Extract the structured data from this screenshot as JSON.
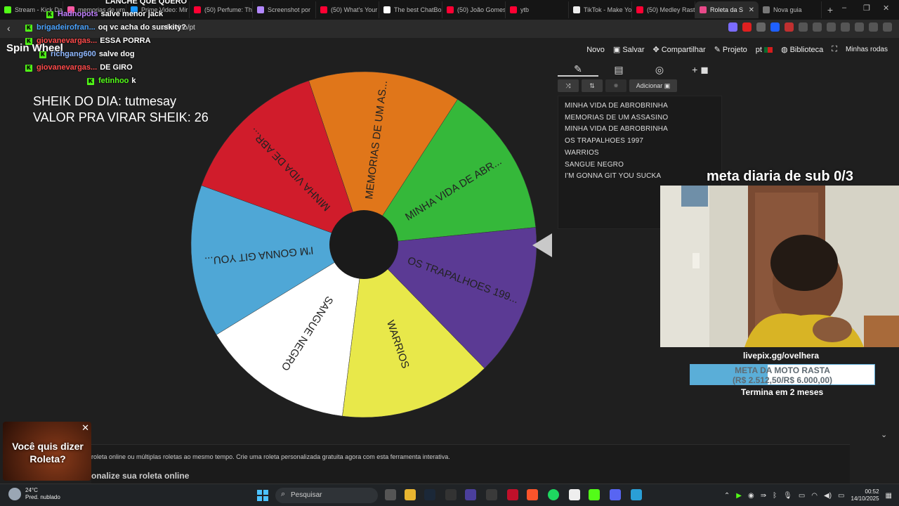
{
  "browser": {
    "tabs": [
      {
        "label": "Stream - Kick Da",
        "color": "#53fc18"
      },
      {
        "label": "memorias de um",
        "color": "#ff5aa5"
      },
      {
        "label": "Prime Video: Mir",
        "color": "#1a98ff"
      },
      {
        "label": "(50) Perfume: Th",
        "color": "#ff0033"
      },
      {
        "label": "Screenshot por",
        "color": "#b388ff"
      },
      {
        "label": "(50) What's Your",
        "color": "#ff0033"
      },
      {
        "label": "The best ChatBo",
        "color": "#ffffff"
      },
      {
        "label": "(50) João Gomes",
        "color": "#ff0033"
      },
      {
        "label": "ytb",
        "color": "#ff0033"
      },
      {
        "label": "TikTok - Make Yo",
        "color": "#eeeeee"
      },
      {
        "label": "(50) Medley Rast",
        "color": "#ff0033"
      },
      {
        "label": "Roleta da S",
        "color": "#e84a8a"
      },
      {
        "label": "Nova guia",
        "color": "#777777"
      }
    ],
    "active_tab_index": 11,
    "url": "wheel.io/pt"
  },
  "header": {
    "logo": "Spin Wheel",
    "menu": [
      "Novo",
      "Salvar",
      "Compartilhar",
      "Projeto",
      "pt",
      "Biblioteca",
      "Minhas rodas"
    ]
  },
  "chat": [
    {
      "user": "",
      "message": "LANCHE QUE QUERO",
      "color": "#ffffff"
    },
    {
      "user": "Hadnopots",
      "message": "salve menor jack",
      "color": "#c080ff"
    },
    {
      "user": "brigadeirofran...",
      "message": "oq vc acha do surskity?",
      "color": "#4aa3ff"
    },
    {
      "user": "giovanevargas...",
      "message": "ESSA PORRA",
      "color": "#ff4a4a"
    },
    {
      "user": "richgang600",
      "message": "salve dog",
      "color": "#8fb8ff"
    },
    {
      "user": "giovanevargas...",
      "message": "DE GIRO",
      "color": "#ff4a4a"
    },
    {
      "user": "fetinhoo",
      "message": "k",
      "color": "#53fc18"
    }
  ],
  "sheik": {
    "line1": "SHEIK DO DIA: tutmesay",
    "line2": "VALOR PRA VIRAR SHEIK: 26"
  },
  "chart_data": {
    "type": "pie",
    "title": "",
    "slices": [
      {
        "label": "MINHA VIDA DE ABR...",
        "color": "#35b83a",
        "value": 1
      },
      {
        "label": "MEMORIAS DE UM AS...",
        "color": "#e0761a",
        "value": 1
      },
      {
        "label": "MINHA VIDA DE ABR...",
        "color": "#d01c2b",
        "value": 1
      },
      {
        "label": "I'M GONNA GIT YOU...",
        "color": "#4fa7d6",
        "value": 1
      },
      {
        "label": "SANGUE NEGRO",
        "color": "#ffffff",
        "value": 1
      },
      {
        "label": "WARRIOS",
        "color": "#e8e84a",
        "value": 1
      },
      {
        "label": "OS TRAPALHOES 199...",
        "color": "#5b3a94",
        "value": 1
      }
    ]
  },
  "panel": {
    "add_label": "Adicionar",
    "entries": [
      "MINHA VIDA DE ABROBRINHA",
      "MEMORIAS DE UM ASSASINO",
      "MINHA VIDA DE ABROBRINHA",
      "OS TRAPALHOES 1997",
      "WARRIOS",
      "SANGUE NEGRO",
      "I'M GONNA GIT YOU SUCKA"
    ]
  },
  "stream": {
    "meta_sub": "meta diaria de sub 0/3",
    "livepix": "livepix.gg/ovelhera",
    "goal_title": "META DA MOTO RASTA",
    "goal_amount": "(R$ 2.512,50/R$ 6.000,00)",
    "goal_progress": 0.419,
    "goal_end": "Termina em 2 meses"
  },
  "promo": {
    "text": "Você quis dizer Roleta?"
  },
  "page": {
    "description": "roleta online ou múltiplas roletas ao mesmo tempo. Crie uma roleta personalizada gratuita agora com esta ferramenta interativa.",
    "subheading": "onalize sua roleta online"
  },
  "taskbar": {
    "temp": "24°C",
    "weather": "Pred. nublado",
    "search_placeholder": "Pesquisar",
    "time": "00:52",
    "date": "14/10/2025"
  }
}
